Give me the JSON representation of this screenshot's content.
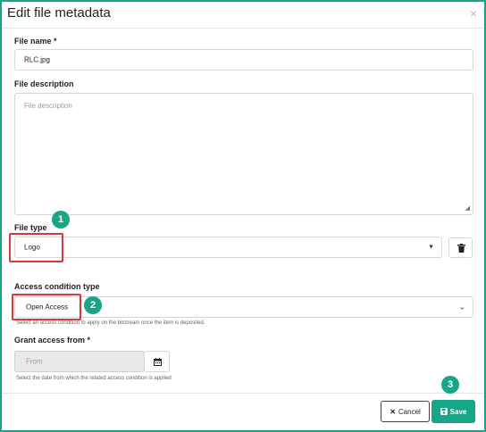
{
  "modal": {
    "title": "Edit file metadata",
    "close_icon": "close-icon"
  },
  "form": {
    "file_name": {
      "label": "File name *",
      "value": "RLC.jpg"
    },
    "file_description": {
      "label": "File description",
      "placeholder": "File description"
    },
    "file_type": {
      "label": "File type",
      "value": "Logo",
      "delete_icon": "trash-icon"
    },
    "access_condition": {
      "label": "Access condition type",
      "value": "Open Access",
      "help": "Select an access condition to apply on the bitstream once the item is deposited."
    },
    "grant_access_from": {
      "label": "Grant access from *",
      "placeholder": "From",
      "calendar_icon": "calendar-icon",
      "help": "Select the date from which the related access condition is applied"
    }
  },
  "annotations": {
    "one": "1",
    "two": "2",
    "three": "3"
  },
  "footer": {
    "cancel_label": "Cancel",
    "save_label": "Save",
    "cancel_icon": "x-icon",
    "save_icon": "floppy-icon"
  },
  "colors": {
    "accent": "#18a689",
    "annotation_box": "#d33a3a"
  }
}
